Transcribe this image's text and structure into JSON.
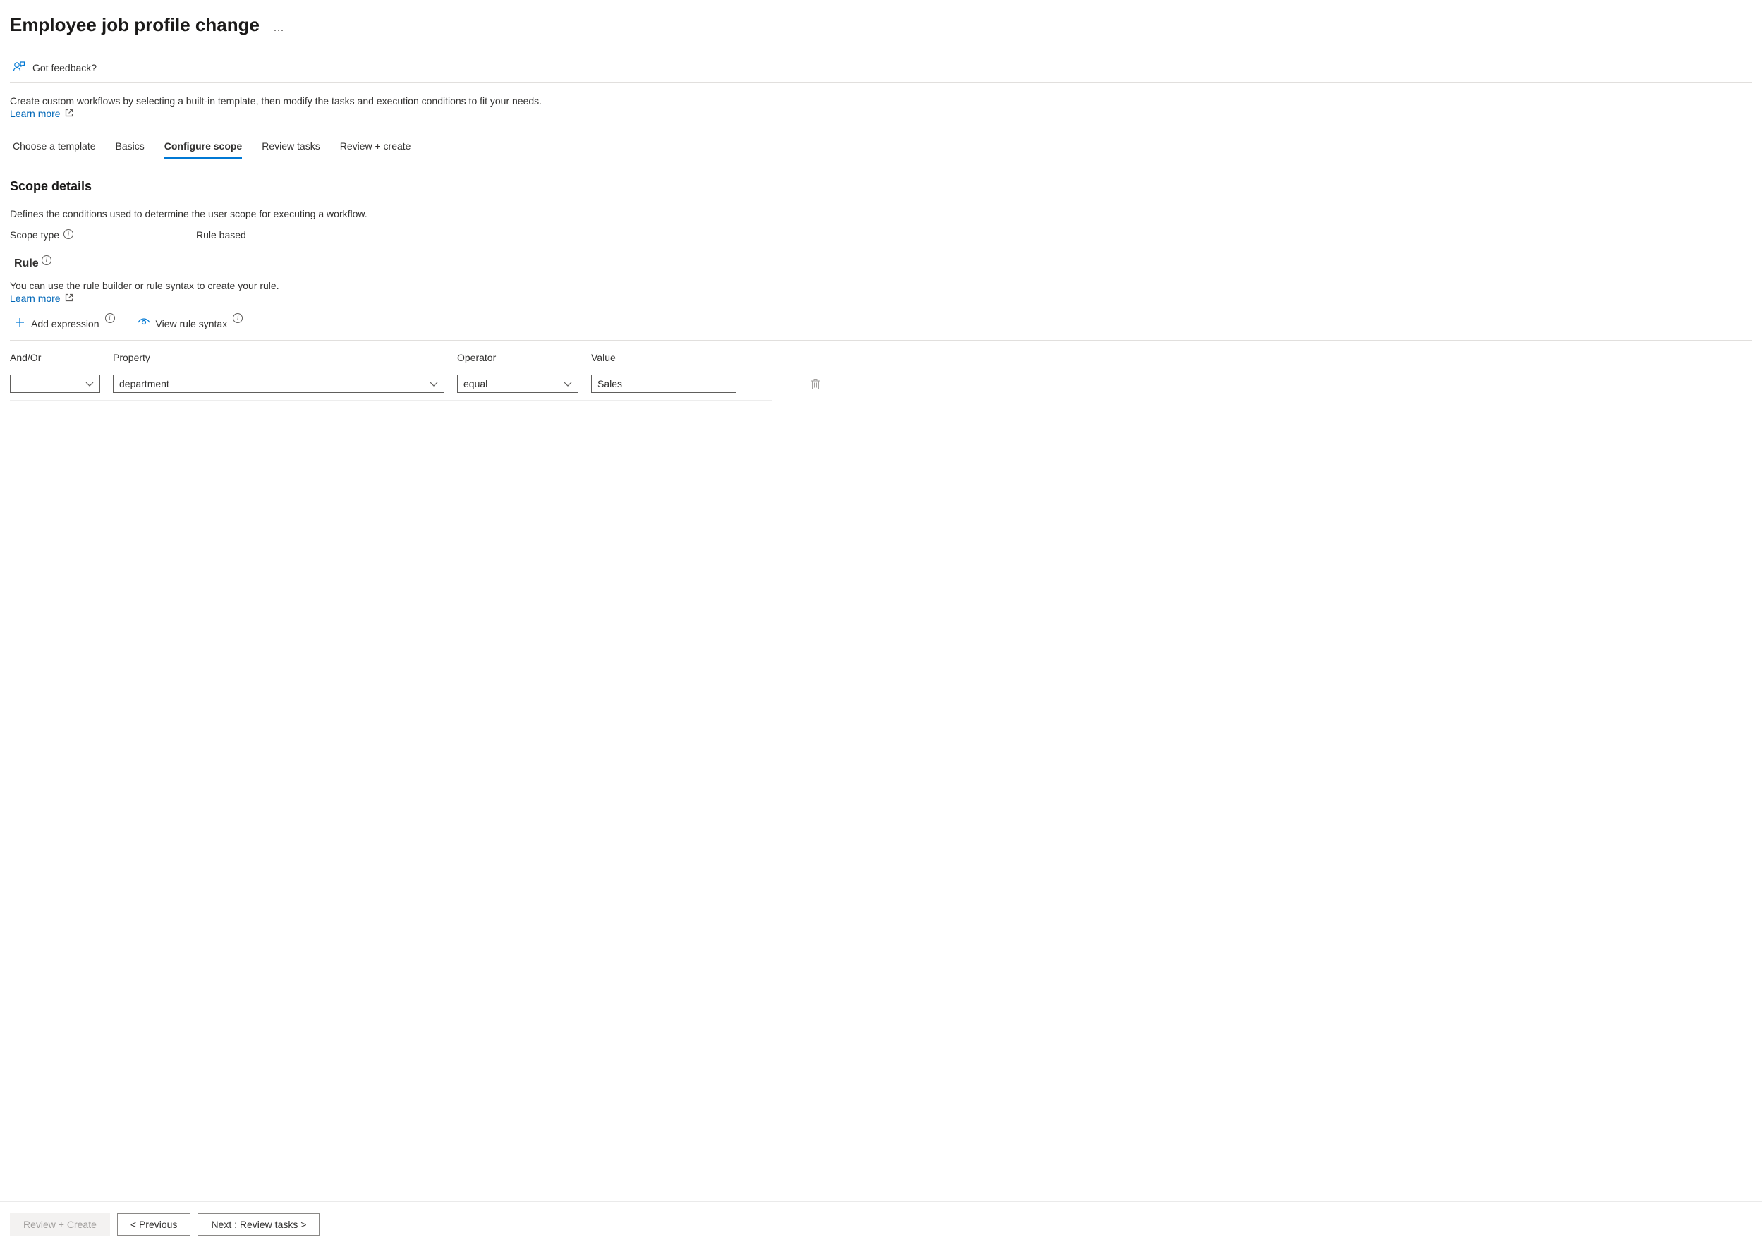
{
  "header": {
    "title": "Employee job profile change"
  },
  "feedback": {
    "label": "Got feedback?"
  },
  "intro": {
    "text": "Create custom workflows by selecting a built-in template, then modify the tasks and execution conditions to fit your needs.",
    "learn_more": "Learn more"
  },
  "tabs": [
    {
      "label": "Choose a template",
      "active": false
    },
    {
      "label": "Basics",
      "active": false
    },
    {
      "label": "Configure scope",
      "active": true
    },
    {
      "label": "Review tasks",
      "active": false
    },
    {
      "label": "Review + create",
      "active": false
    }
  ],
  "scope": {
    "heading": "Scope details",
    "description": "Defines the conditions used to determine the user scope for executing a workflow.",
    "scope_type_label": "Scope type",
    "scope_type_value": "Rule based"
  },
  "rule": {
    "heading": "Rule",
    "description": "You can use the rule builder or rule syntax to create your rule.",
    "learn_more": "Learn more",
    "add_expression": "Add expression",
    "view_syntax": "View rule syntax"
  },
  "table": {
    "headers": {
      "andor": "And/Or",
      "property": "Property",
      "operator": "Operator",
      "value": "Value"
    },
    "rows": [
      {
        "andor": "",
        "property": "department",
        "operator": "equal",
        "value": "Sales"
      }
    ]
  },
  "footer": {
    "review_create": "Review + Create",
    "previous": "< Previous",
    "next": "Next : Review tasks >"
  }
}
